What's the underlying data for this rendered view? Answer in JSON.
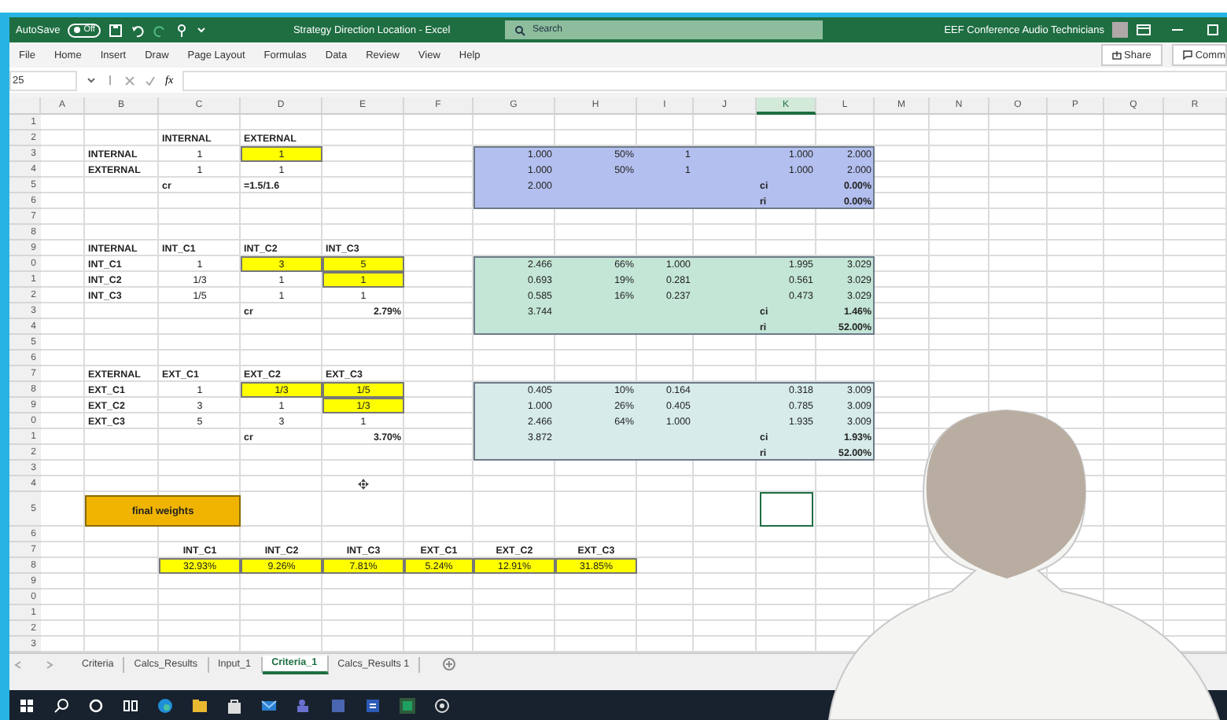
{
  "title_bar": {
    "autosave_label": "AutoSave",
    "autosave_state": "Off",
    "autosave_on": false,
    "document_title": "Strategy Direction Location - Excel",
    "search_placeholder": "Search",
    "user_name": "EEF Conference Audio Technicians"
  },
  "menu": {
    "items": [
      {
        "label": "File",
        "selected": false
      },
      {
        "label": "Home",
        "selected": false
      },
      {
        "label": "Insert",
        "selected": false
      },
      {
        "label": "Draw",
        "selected": false
      },
      {
        "label": "Page Layout",
        "selected": false
      },
      {
        "label": "Formulas",
        "selected": false
      },
      {
        "label": "Data",
        "selected": false
      },
      {
        "label": "Review",
        "selected": false
      },
      {
        "label": "View",
        "selected": false
      },
      {
        "label": "Help",
        "selected": false
      }
    ],
    "share": "Share",
    "comments": "Comm"
  },
  "formula_bar": {
    "name_box": "25",
    "fx": "fx"
  },
  "sheet": {
    "columns": [
      {
        "label": "A",
        "selected": false
      },
      {
        "label": "B",
        "selected": false
      },
      {
        "label": "C",
        "selected": false
      },
      {
        "label": "D",
        "selected": false
      },
      {
        "label": "E",
        "selected": false
      },
      {
        "label": "F",
        "selected": false
      },
      {
        "label": "G",
        "selected": false
      },
      {
        "label": "H",
        "selected": false
      },
      {
        "label": "I",
        "selected": false
      },
      {
        "label": "J",
        "selected": false
      },
      {
        "label": "K",
        "selected": true
      },
      {
        "label": "L",
        "selected": false
      },
      {
        "label": "M",
        "selected": false
      },
      {
        "label": "N",
        "selected": false
      },
      {
        "label": "O",
        "selected": false
      },
      {
        "label": "P",
        "selected": false
      },
      {
        "label": "Q",
        "selected": false
      },
      {
        "label": "R",
        "selected": false
      }
    ],
    "row_headers": [
      "1",
      "2",
      "3",
      "4",
      "5",
      "6",
      "7",
      "8",
      "9",
      "0",
      "1",
      "2",
      "3",
      "4",
      "5",
      "6",
      "7",
      "8",
      "9",
      "0",
      "1",
      "2",
      "3",
      "4",
      "5",
      "6",
      "7",
      "8",
      "9",
      "0",
      "1",
      "2",
      "3"
    ],
    "matrices": [
      {
        "headers": [
          "INTERNAL",
          "EXTERNAL"
        ],
        "rows": [
          {
            "label": "INTERNAL",
            "values": [
              {
                "text": "1"
              },
              {
                "text": "1",
                "color": "#ffff00"
              }
            ]
          },
          {
            "label": "EXTERNAL",
            "values": [
              {
                "text": "1"
              },
              {
                "text": "1"
              }
            ]
          }
        ],
        "cr_label": "cr",
        "cr_value": "=1.5/1.6"
      },
      {
        "corner": "INTERNAL",
        "headers": [
          "INT_C1",
          "INT_C2",
          "INT_C3"
        ],
        "rows": [
          {
            "label": "INT_C1",
            "values": [
              {
                "text": "1"
              },
              {
                "text": "3",
                "color": "#ffff00"
              },
              {
                "text": "5",
                "color": "#ffff00"
              }
            ]
          },
          {
            "label": "INT_C2",
            "values": [
              {
                "text": "1/3"
              },
              {
                "text": "1"
              },
              {
                "text": "1",
                "color": "#ffff00"
              }
            ]
          },
          {
            "label": "INT_C3",
            "values": [
              {
                "text": "1/5"
              },
              {
                "text": "1"
              },
              {
                "text": "1"
              }
            ]
          }
        ],
        "cr_label": "cr",
        "cr_value": "2.79%"
      },
      {
        "corner": "EXTERNAL",
        "headers": [
          "EXT_C1",
          "EXT_C2",
          "EXT_C3"
        ],
        "rows": [
          {
            "label": "EXT_C1",
            "values": [
              {
                "text": "1"
              },
              {
                "text": "1/3",
                "color": "#ffff00"
              },
              {
                "text": "1/5",
                "color": "#ffff00"
              }
            ]
          },
          {
            "label": "EXT_C2",
            "values": [
              {
                "text": "3"
              },
              {
                "text": "1"
              },
              {
                "text": "1/3",
                "color": "#ffff00"
              }
            ]
          },
          {
            "label": "EXT_C3",
            "values": [
              {
                "text": "5"
              },
              {
                "text": "3"
              },
              {
                "text": "1"
              }
            ]
          }
        ],
        "cr_label": "cr",
        "cr_value": "3.70%"
      }
    ],
    "result_blocks": [
      {
        "color": "#b3bfee",
        "rows": [
          [
            "1.000",
            "50%",
            "1",
            "1.000",
            "2.000"
          ],
          [
            "1.000",
            "50%",
            "1",
            "1.000",
            "2.000"
          ]
        ],
        "total": "2.000",
        "ci_label": "ci",
        "ci": "0.00%",
        "ri_label": "ri",
        "ri": "0.00%"
      },
      {
        "color": "#c4e6d6",
        "rows": [
          [
            "2.466",
            "66%",
            "1.000",
            "1.995",
            "3.029"
          ],
          [
            "0.693",
            "19%",
            "0.281",
            "0.561",
            "3.029"
          ],
          [
            "0.585",
            "16%",
            "0.237",
            "0.473",
            "3.029"
          ]
        ],
        "total": "3.744",
        "ci_label": "ci",
        "ci": "1.46%",
        "ri_label": "ri",
        "ri": "52.00%"
      },
      {
        "color": "#d7ecea",
        "rows": [
          [
            "0.405",
            "10%",
            "0.164",
            "0.318",
            "3.009"
          ],
          [
            "1.000",
            "26%",
            "0.405",
            "0.785",
            "3.009"
          ],
          [
            "2.466",
            "64%",
            "1.000",
            "1.935",
            "3.009"
          ]
        ],
        "total": "3.872",
        "ci_label": "ci",
        "ci": "1.93%",
        "ri_label": "ri",
        "ri": "52.00%"
      }
    ],
    "shape": {
      "label": "final weights",
      "color": "#f0b400"
    },
    "final_weights": {
      "headers": [
        "INT_C1",
        "INT_C2",
        "INT_C3",
        "EXT_C1",
        "EXT_C2",
        "EXT_C3"
      ],
      "values": [
        {
          "text": "32.93%",
          "color": "#ffff00"
        },
        {
          "text": "9.26%",
          "color": "#ffff00"
        },
        {
          "text": "7.81%",
          "color": "#ffff00"
        },
        {
          "text": "5.24%",
          "color": "#ffff00"
        },
        {
          "text": "12.91%",
          "color": "#ffff00"
        },
        {
          "text": "31.85%",
          "color": "#ffff00"
        }
      ]
    }
  },
  "sheet_tabs": [
    {
      "label": "Criteria",
      "selected": false
    },
    {
      "label": "Calcs_Results",
      "selected": false
    },
    {
      "label": "Input_1",
      "selected": false
    },
    {
      "label": "Criteria_1",
      "selected": true
    },
    {
      "label": "Calcs_Results 1",
      "selected": false
    }
  ]
}
